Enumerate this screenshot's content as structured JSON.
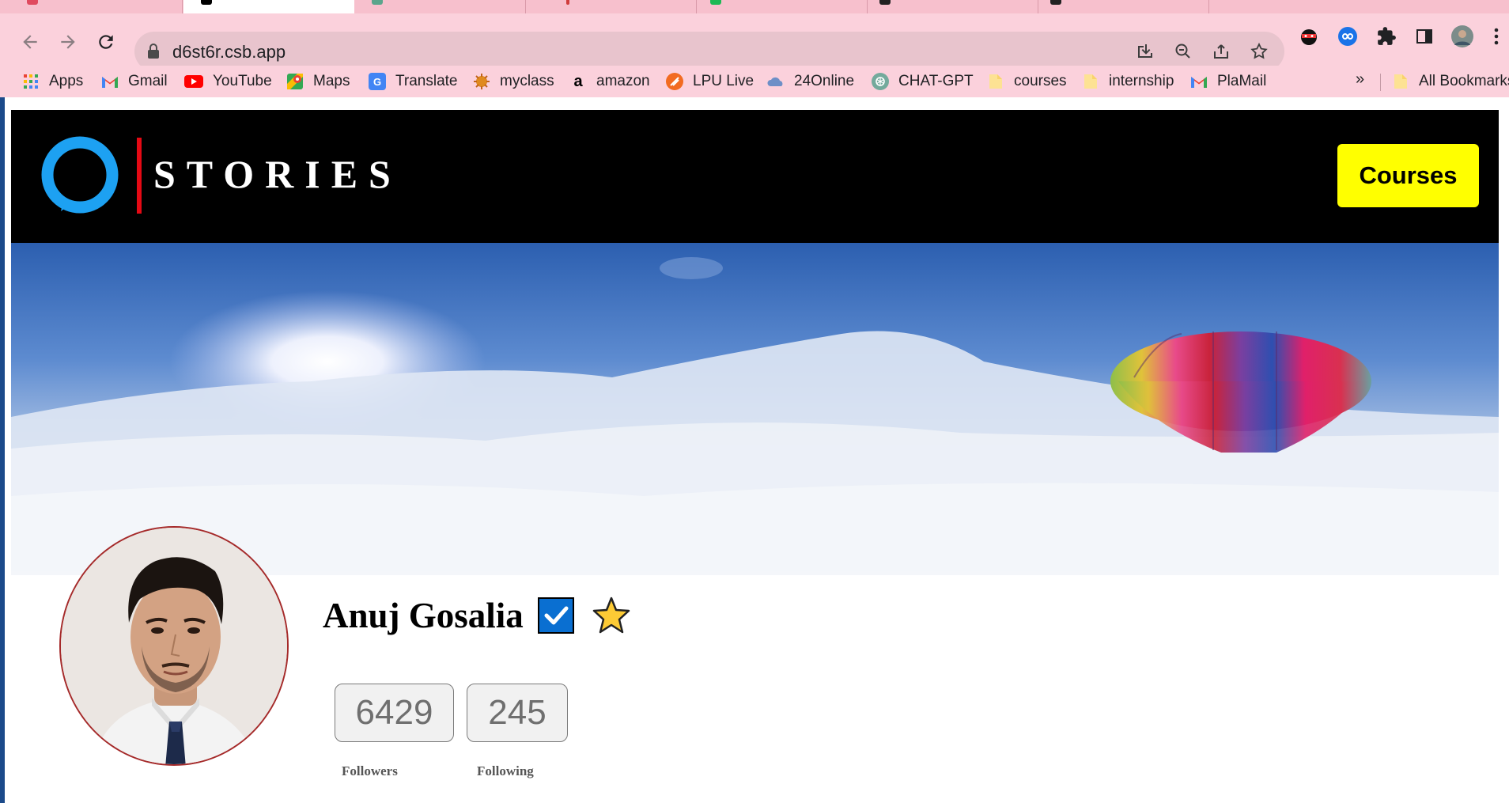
{
  "browser": {
    "url": "d6st6r.csb.app",
    "bookmarks": [
      {
        "label": "Apps",
        "icon": "apps-grid-icon"
      },
      {
        "label": "Gmail",
        "icon": "gmail-icon"
      },
      {
        "label": "YouTube",
        "icon": "youtube-icon"
      },
      {
        "label": "Maps",
        "icon": "maps-icon"
      },
      {
        "label": "Translate",
        "icon": "translate-icon"
      },
      {
        "label": "myclass",
        "icon": "myclass-icon"
      },
      {
        "label": "amazon",
        "icon": "amazon-icon"
      },
      {
        "label": "LPU Live",
        "icon": "lpu-live-icon"
      },
      {
        "label": "24Online",
        "icon": "cloud-icon"
      },
      {
        "label": "CHAT-GPT",
        "icon": "chatgpt-icon"
      },
      {
        "label": "courses",
        "icon": "folder-icon"
      },
      {
        "label": "internship",
        "icon": "folder-icon"
      },
      {
        "label": "PlaMail",
        "icon": "gmail-icon"
      }
    ],
    "more_label": "»",
    "all_bookmarks": "All Bookmarks"
  },
  "site": {
    "logo_text": "STORIES",
    "courses_button": "Courses",
    "brand_colors": {
      "header_bg": "#000000",
      "accent_red": "#e50914",
      "button_yellow": "#ffff00",
      "ring_blue": "#1da1f2"
    }
  },
  "profile": {
    "name": "Anuj Gosalia",
    "verified_icon": "check-box-icon",
    "star_icon": "star-icon",
    "followers_count": "6429",
    "followers_label": "Followers",
    "following_count": "245",
    "following_label": "Following"
  }
}
